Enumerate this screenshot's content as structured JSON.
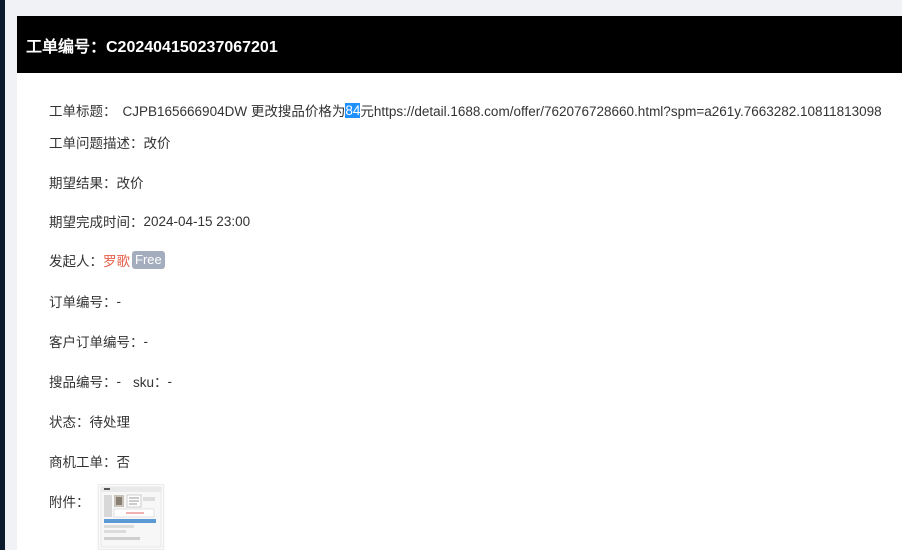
{
  "header": {
    "title": "工单编号：C202404150237067201"
  },
  "fields": {
    "title_label": "工单标题：",
    "title_prefix": "CJPB165666904DW  更改搜品价格为",
    "title_highlight": "84",
    "title_suffix": "元https://detail.1688.com/offer/762076728660.html?spm=a261y.7663282.10811813098",
    "desc_label": "工单问题描述：",
    "desc_value": "改价",
    "expect_label": "期望结果：",
    "expect_value": "改价",
    "deadline_label": "期望完成时间：",
    "deadline_value": "2024-04-15 23:00",
    "initiator_label": "发起人：",
    "initiator_value": "罗歌",
    "initiator_badge": "Free",
    "order_label": "订单编号：",
    "order_value": "-",
    "customer_order_label": "客户订单编号：",
    "customer_order_value": "-",
    "product_label": "搜品编号：",
    "product_value": "-",
    "sku_label": "sku：",
    "sku_value": "-",
    "status_label": "状态：",
    "status_value": "待处理",
    "opportunity_label": "商机工单：",
    "opportunity_value": "否",
    "attachment_label": "附件："
  },
  "colors": {
    "header_bg": "#000000",
    "highlight": "#1e90ff",
    "initiator": "#e5604a",
    "badge_bg": "#a3adbd"
  }
}
